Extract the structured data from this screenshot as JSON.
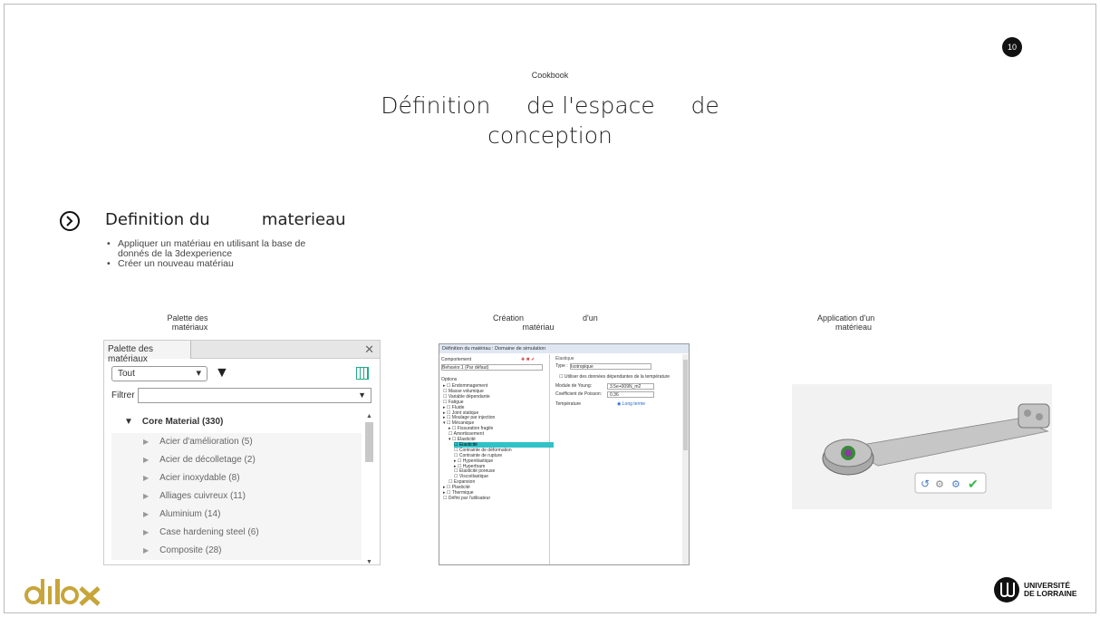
{
  "page_number": "10",
  "kicker": "Cookbook",
  "title": "Définition     de l'espace     de\nconception",
  "section": {
    "title": "Definition du          materieau",
    "icon": "chevron-circle-icon"
  },
  "bullets": [
    "Appliquer      un matériau en utilisant la base de",
    "donnés de la 3dexperience",
    "Créer un nouveau matériau"
  ],
  "captions": {
    "palette": "Palette des\n  matériaux",
    "creation": "Création                          d'un\n             matériau",
    "application": "Application d'un\n        matérieau"
  },
  "palette": {
    "tab": "Palette des matériaux",
    "select_value": "Tout",
    "filter_label": "Filtrer",
    "root": "Core Material (330)",
    "items": [
      "Acier d'amélioration (5)",
      "Acier de décolletage (2)",
      "Acier inoxydable (8)",
      "Alliages cuivreux (11)",
      "Aluminium (14)",
      "Case hardening steel (6)",
      "Composite (28)"
    ]
  },
  "dialog": {
    "title": "Définition du matériau : Domaine de simulation",
    "comportement": "Comportement",
    "behavior": "Behavior.1 (Par défaut)",
    "options": "Options",
    "tree": [
      "Endommagement",
      "Masse volumique",
      "Variable dépendante",
      "Fatigue",
      "Fluide",
      "Joint statique",
      "Moulage par injection",
      "Mécanique",
      "Fissuration fragile",
      "Amortissement",
      "Elasticité",
      "Elasticité",
      "Contrainte de déformation",
      "Contrainte de rupture",
      "Hyperélastique",
      "Hyperfoam",
      "Elasticité poreuse",
      "Viscoélastique",
      "Expansion",
      "Plasticité",
      "Thermique",
      "Défini par l'utilisateur"
    ],
    "elastique": "Elastique",
    "type_label": "Type :",
    "type_value": "Isotropique",
    "temp_dep": "Utiliser des données dépendantes de la température",
    "young_label": "Module de Young:",
    "young_value": "3.5e+009N_m2",
    "poisson_label": "Coefficient de Poisson:",
    "poisson_value": "0.36",
    "temp_label": "Température",
    "long_term": "Long terme"
  }
}
